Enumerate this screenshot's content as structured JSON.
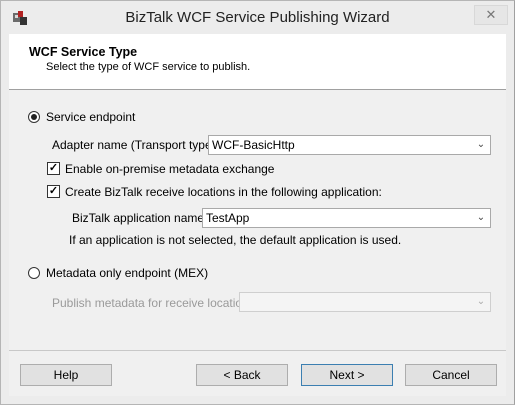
{
  "window": {
    "title": "BizTalk WCF Service Publishing Wizard",
    "close_glyph": "✕"
  },
  "header": {
    "title": "WCF Service Type",
    "subtitle": "Select the type of WCF service to publish."
  },
  "service_endpoint": {
    "label": "Service endpoint",
    "selected": true,
    "adapter_label": "Adapter name (Transport type):",
    "adapter_value": "WCF-BasicHttp",
    "metadata_exchange_label": "Enable on-premise metadata exchange",
    "metadata_exchange_checked": true,
    "create_receive_label": "Create BizTalk receive locations in the following application:",
    "create_receive_checked": true,
    "app_name_label": "BizTalk application name:",
    "app_name_value": "TestApp",
    "app_note": "If an application is not selected, the default application is used."
  },
  "mex_endpoint": {
    "label": "Metadata only endpoint (MEX)",
    "selected": false,
    "publish_label": "Publish metadata for receive location:",
    "publish_value": ""
  },
  "buttons": {
    "help": "Help",
    "back": "< Back",
    "next": "Next >",
    "cancel": "Cancel"
  },
  "icons": {
    "check_glyph": "✓",
    "dropdown_glyph": "⌄"
  },
  "colors": {
    "dialog_bg": "#f0f0f0",
    "header_bg": "#ffffff",
    "default_button_border": "#3c7fb1"
  }
}
